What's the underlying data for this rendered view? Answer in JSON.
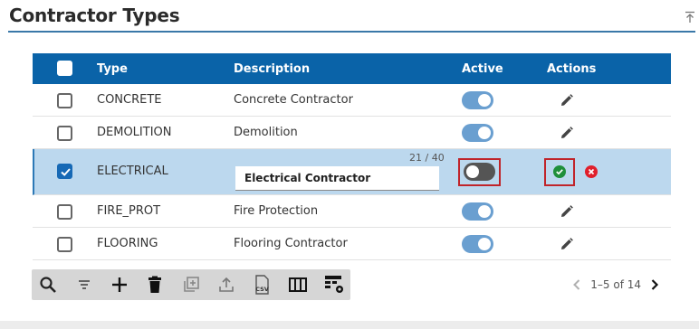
{
  "page": {
    "title": "Contractor Types"
  },
  "table": {
    "headers": {
      "type": "Type",
      "description": "Description",
      "active": "Active",
      "actions": "Actions"
    },
    "rows": [
      {
        "type": "CONCRETE",
        "description": "Concrete Contractor",
        "active": true,
        "checked": false
      },
      {
        "type": "DEMOLITION",
        "description": "Demolition",
        "active": true,
        "checked": false
      },
      {
        "type": "ELECTRICAL",
        "description": "Electrical Contractor",
        "active": false,
        "checked": true,
        "editing": true,
        "char_count": "21 / 40"
      },
      {
        "type": "FIRE_PROT",
        "description": "Fire Protection",
        "active": true,
        "checked": false
      },
      {
        "type": "FLOORING",
        "description": "Flooring Contractor",
        "active": true,
        "checked": false
      }
    ]
  },
  "toolbar": {
    "icons": [
      "search-icon",
      "filter-icon",
      "add-icon",
      "delete-icon",
      "duplicate-icon",
      "export-icon",
      "csv-icon",
      "columns-icon",
      "table-settings-icon"
    ],
    "csv_label": "CSV"
  },
  "pager": {
    "range": "1–5 of 14"
  },
  "colors": {
    "header": "#0a63a8",
    "selected_row": "#bcd8ee",
    "toggle_on": "#6a9fd0",
    "toggle_off": "#555555",
    "highlight_box": "#c0242a",
    "confirm": "#1e8f3a",
    "cancel": "#e01f2b"
  }
}
